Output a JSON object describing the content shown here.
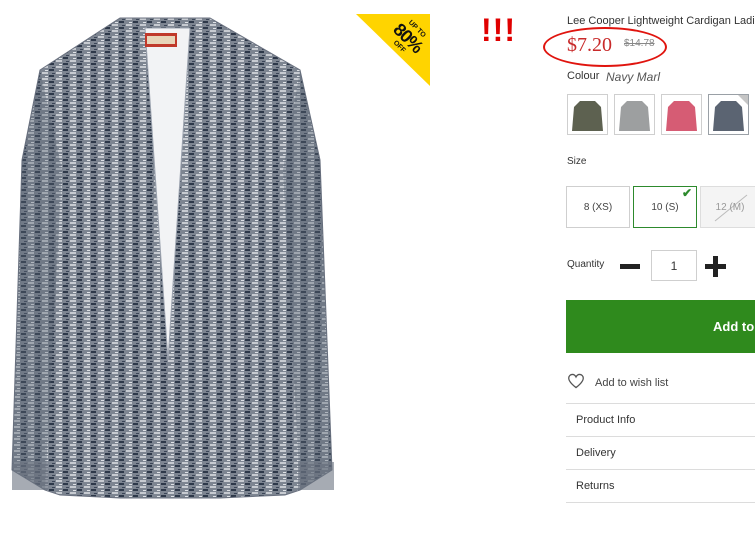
{
  "promo": {
    "line1": "UP TO",
    "line2": "80%",
    "line3": "OFF"
  },
  "annotation": {
    "exclaim": "!!!"
  },
  "product": {
    "title": "Lee Cooper Lightweight Cardigan Ladies",
    "price_now": "$7.20",
    "price_was": "$14.78"
  },
  "colour": {
    "label": "Colour",
    "selected": "Navy Marl",
    "swatches": [
      {
        "name": "Khaki",
        "color": "#5d6150"
      },
      {
        "name": "Grey",
        "color": "#9d9fa0"
      },
      {
        "name": "Pink",
        "color": "#d65c74"
      },
      {
        "name": "Navy Marl",
        "color": "#5b6472"
      }
    ]
  },
  "size": {
    "label": "Size",
    "options": [
      {
        "label": "8 (XS)",
        "state": "available"
      },
      {
        "label": "10 (S)",
        "state": "selected"
      },
      {
        "label": "12 (M)",
        "state": "unavailable"
      }
    ]
  },
  "quantity": {
    "label": "Quantity",
    "value": "1"
  },
  "add_button": {
    "label": "Add to Bag"
  },
  "wishlist": {
    "label": "Add to wish list"
  },
  "accordion": [
    {
      "label": "Product Info"
    },
    {
      "label": "Delivery"
    },
    {
      "label": "Returns"
    }
  ],
  "colors": {
    "accent_green": "#2f8a1d",
    "price_red": "#c82a2a",
    "promo_yellow": "#ffd400",
    "annotation_red": "#e00000"
  }
}
